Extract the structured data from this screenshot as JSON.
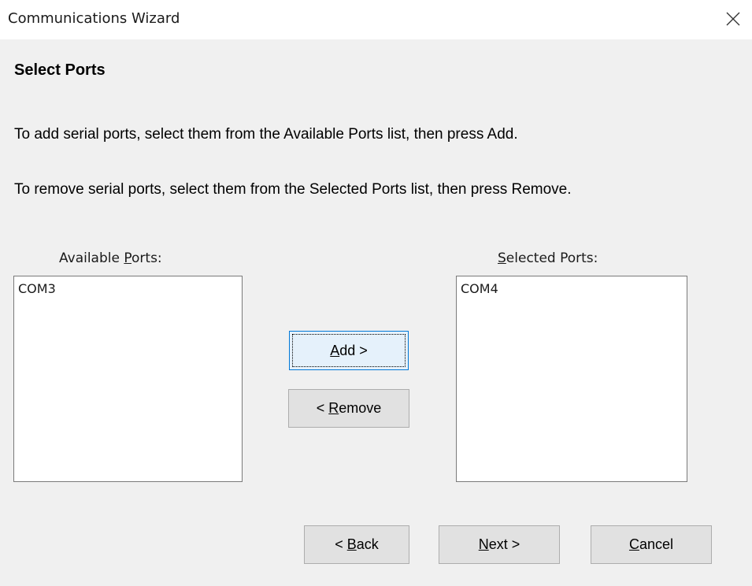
{
  "window": {
    "title": "Communications Wizard",
    "close_icon": "close-icon"
  },
  "page": {
    "heading": "Select Ports",
    "instruction_add": "To add serial ports, select them from the Available Ports list, then press Add.",
    "instruction_remove": "To remove serial ports, select them from the Selected Ports list, then press Remove."
  },
  "available": {
    "label_pre": "Available ",
    "label_mnemonic": "P",
    "label_post": "orts:",
    "items": [
      "COM3"
    ]
  },
  "selected": {
    "label_pre": "",
    "label_mnemonic": "S",
    "label_post": "elected Ports:",
    "items": [
      "COM4"
    ]
  },
  "buttons": {
    "add": {
      "pre": "",
      "mnemonic": "A",
      "post": "dd >"
    },
    "remove": {
      "pre": "< ",
      "mnemonic": "R",
      "post": "emove"
    },
    "back": {
      "pre": "< ",
      "mnemonic": "B",
      "post": "ack"
    },
    "next": {
      "pre": "",
      "mnemonic": "N",
      "post": "ext >"
    },
    "cancel": {
      "pre": "",
      "mnemonic": "C",
      "post": "ancel"
    }
  }
}
